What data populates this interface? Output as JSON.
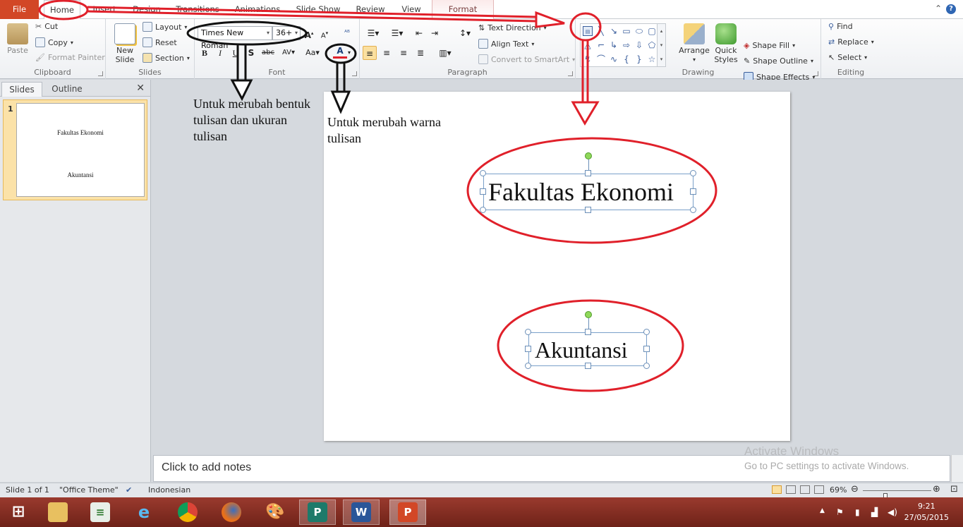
{
  "ribbon_tabs": {
    "file": "File",
    "home": "Home",
    "insert": "Insert",
    "design": "Design",
    "transitions": "Transitions",
    "animations": "Animations",
    "slide_show": "Slide Show",
    "review": "Review",
    "view": "View",
    "format": "Format"
  },
  "clipboard": {
    "paste": "Paste",
    "cut": "Cut",
    "copy": "Copy",
    "format_painter": "Format Painter",
    "label": "Clipboard"
  },
  "slides_group": {
    "new_slide_1": "New",
    "new_slide_2": "Slide",
    "layout": "Layout",
    "reset": "Reset",
    "section": "Section",
    "label": "Slides"
  },
  "font": {
    "name": "Times New Roman",
    "size": "36+",
    "label": "Font"
  },
  "paragraph": {
    "text_direction": "Text Direction",
    "align_text": "Align Text",
    "convert_smartart": "Convert to SmartArt",
    "label": "Paragraph"
  },
  "drawing": {
    "arrange": "Arrange",
    "quick_styles_1": "Quick",
    "quick_styles_2": "Styles",
    "shape_fill": "Shape Fill",
    "shape_outline": "Shape Outline",
    "shape_effects": "Shape Effects",
    "label": "Drawing"
  },
  "editing": {
    "find": "Find",
    "replace": "Replace",
    "select": "Select",
    "label": "Editing"
  },
  "slides_pane": {
    "tab_slides": "Slides",
    "tab_outline": "Outline",
    "slide_number": "1",
    "thumb_title": "Fakultas Ekonomi",
    "thumb_subtitle": "Akuntansi"
  },
  "slide": {
    "title": "Fakultas Ekonomi",
    "subtitle": "Akuntansi"
  },
  "annotations": {
    "font_note": "Untuk merubah bentuk tulisan dan ukuran tulisan",
    "color_note": "Untuk merubah warna tulisan"
  },
  "notes": {
    "placeholder": "Click to add notes"
  },
  "watermark": {
    "line1": "Activate Windows",
    "line2": "Go to PC settings to activate Windows."
  },
  "status": {
    "slide_info": "Slide 1 of 1",
    "theme": "\"Office Theme\"",
    "language": "Indonesian",
    "zoom": "69%",
    "zoom_fraction": 0.69
  },
  "clock": {
    "time": "9:21",
    "date": "27/05/2015"
  },
  "colors": {
    "file_tab": "#d24726",
    "annotation_red": "#e0202a",
    "taskbar": "#8a2e22",
    "selected_thumb": "#fbe2a8"
  }
}
